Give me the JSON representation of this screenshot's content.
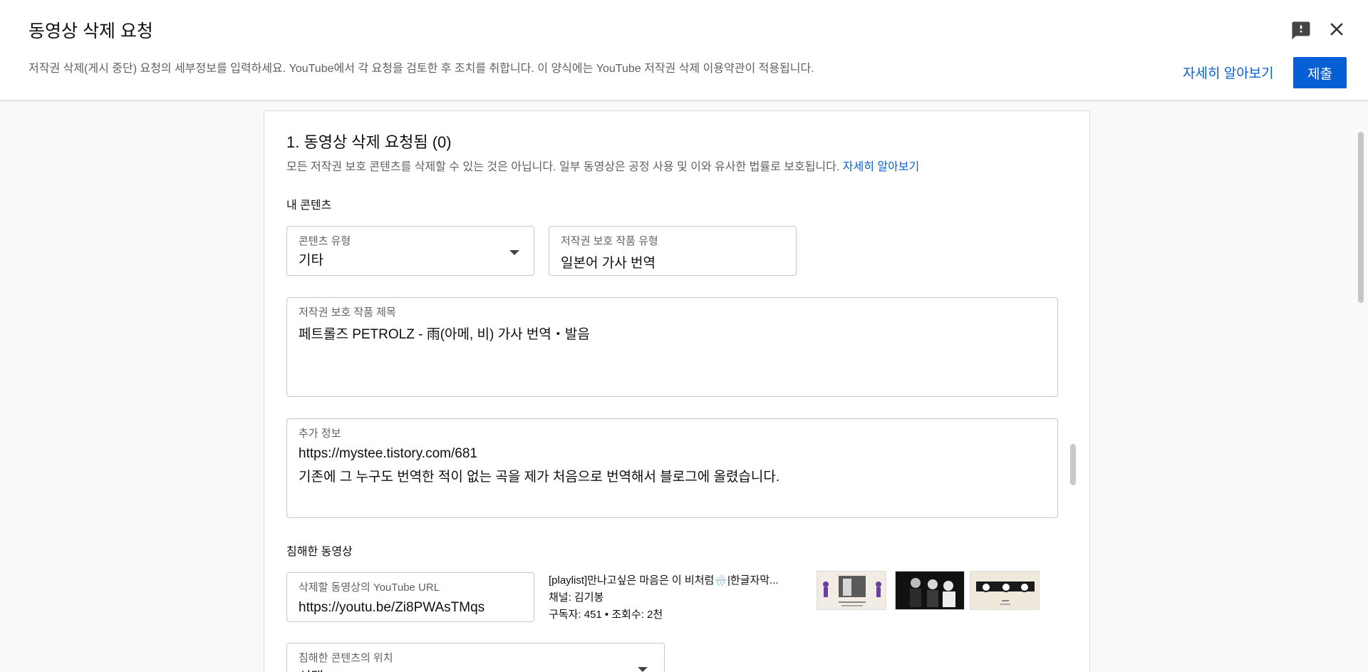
{
  "header": {
    "title": "동영상 삭제 요청",
    "description": "저작권 삭제(게시 중단) 요청의 세부정보를 입력하세요. YouTube에서 각 요청을 검토한 후 조치를 취합니다. 이 양식에는 YouTube 저작권 삭제 이용약관이 적용됩니다.",
    "learn_more": "자세히 알아보기",
    "submit": "제출"
  },
  "section": {
    "title": "1. 동영상 삭제 요청됨 (0)",
    "description": "모든 저작권 보호 콘텐츠를 삭제할 수 있는 것은 아닙니다. 일부 동영상은 공정 사용 및 이와 유사한 법률로 보호됩니다.",
    "learn_more": "자세히 알아보기",
    "my_content_label": "내 콘텐츠",
    "content_type": {
      "label": "콘텐츠 유형",
      "value": "기타"
    },
    "work_type": {
      "label": "저작권 보호 작품 유형",
      "value": "일본어 가사 번역"
    },
    "work_title": {
      "label": "저작권 보호 작품 제목",
      "value": "페트롤즈 PETROLZ - 雨(아메, 비) 가사 번역・발음"
    },
    "additional_info": {
      "label": "추가 정보",
      "line1": "https://mystee.tistory.com/681",
      "line2": "기존에 그 누구도 번역한 적이 없는 곡을 제가 처음으로 번역해서 블로그에 올렸습니다."
    },
    "infringing_label": "침해한 동영상",
    "video_url": {
      "label": "삭제할 동영상의 YouTube URL",
      "value": "https://youtu.be/Zi8PWAsTMqs"
    },
    "video": {
      "title": "[playlist]만나고싶은 마음은 이 비처럼🌧️|한글자막...",
      "channel": "채널: 김기봉",
      "stats": "구독자: 451 • 조회수: 2천"
    },
    "location": {
      "label": "침해한 콘텐츠의 위치",
      "value": "선택"
    }
  },
  "colors": {
    "accent": "#065fd4",
    "text": "#0f0f0f",
    "muted": "#606060"
  },
  "icons": {
    "feedback": "feedback-icon",
    "close": "close-icon",
    "dropdown": "caret-down-icon"
  }
}
